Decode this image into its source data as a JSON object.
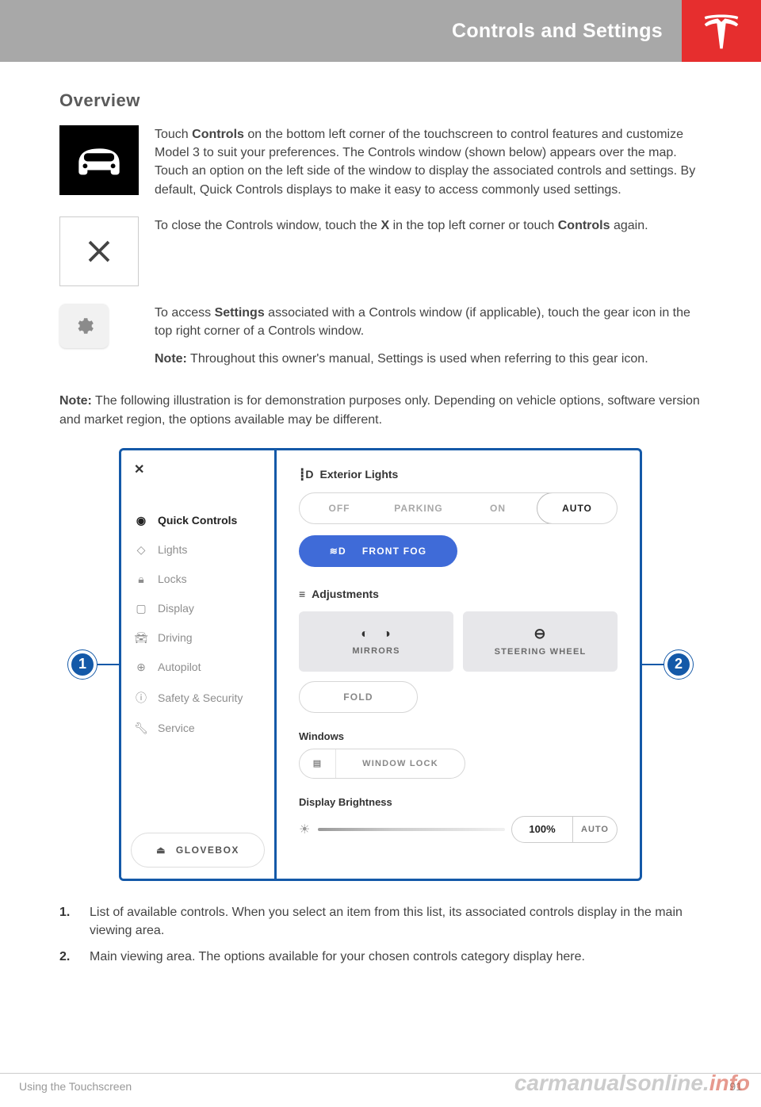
{
  "header": {
    "title": "Controls and Settings"
  },
  "section": {
    "overview": "Overview"
  },
  "para": {
    "p1_pre": "Touch ",
    "p1_b": "Controls",
    "p1_post": " on the bottom left corner of the touchscreen to control features and customize Model 3 to suit your preferences. The Controls window (shown below) appears over the map. Touch an option on the left side of the window to display the associated controls and settings. By default, Quick Controls displays to make it easy to access commonly used settings.",
    "p2_pre": "To close the Controls window, touch the ",
    "p2_b1": "X",
    "p2_mid": " in the top left corner or touch ",
    "p2_b2": "Controls",
    "p2_post": " again.",
    "p3_pre": "To access ",
    "p3_b": "Settings",
    "p3_post": " associated with a Controls window (if applicable), touch the gear icon in the top right corner of a Controls window.",
    "p3note_b": "Note:",
    "p3note": " Throughout this owner's manual, Settings is used when referring to this gear icon.",
    "p4_b": "Note:",
    "p4": " The following illustration is for demonstration purposes only. Depending on vehicle options, software version and market region, the options available may be different."
  },
  "callout": {
    "one": "1",
    "two": "2"
  },
  "nav": {
    "x": "✕",
    "items": [
      "Quick Controls",
      "Lights",
      "Locks",
      "Display",
      "Driving",
      "Autopilot",
      "Safety & Security",
      "Service"
    ],
    "glovebox": "GLOVEBOX"
  },
  "panel": {
    "ext_lights": "Exterior Lights",
    "seg": [
      "OFF",
      "PARKING",
      "ON",
      "AUTO"
    ],
    "front_fog": "FRONT FOG",
    "adjustments": "Adjustments",
    "mirrors": "MIRRORS",
    "steering": "STEERING WHEEL",
    "fold": "FOLD",
    "windows": "Windows",
    "window_lock": "WINDOW LOCK",
    "brightness_head": "Display Brightness",
    "pct": "100%",
    "auto": "AUTO"
  },
  "list": {
    "n1": "1.",
    "t1": "List of available controls. When you select an item from this list, its associated controls display in the main viewing area.",
    "n2": "2.",
    "t2": "Main viewing area. The options available for your chosen controls category display here."
  },
  "footer": {
    "left": "Using the Touchscreen",
    "right": "91"
  },
  "watermark": {
    "a": "carmanualsonline.",
    "b": "info"
  }
}
